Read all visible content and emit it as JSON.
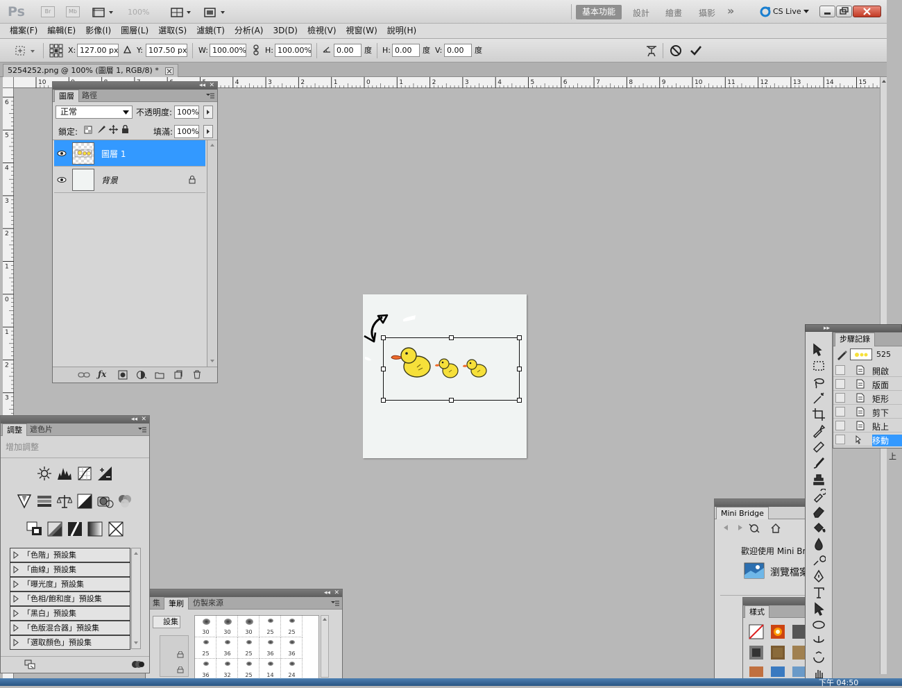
{
  "app": {
    "logo": "Ps",
    "bridge": "Br",
    "minibridge": "Mb",
    "zoom": "100%",
    "workspaces": [
      "基本功能",
      "設計",
      "繪畫",
      "攝影"
    ],
    "more": "»",
    "cslive": "CS Live"
  },
  "menu": [
    "檔案(F)",
    "編輯(E)",
    "影像(I)",
    "圖層(L)",
    "選取(S)",
    "濾鏡(T)",
    "分析(A)",
    "3D(D)",
    "檢視(V)",
    "視窗(W)",
    "說明(H)"
  ],
  "options": {
    "x_label": "X:",
    "x": "127.00 px",
    "y_label": "Y:",
    "y": "107.50 px",
    "w_label": "W:",
    "w": "100.00%",
    "h_label": "H:",
    "h": "100.00%",
    "angle": "0.00",
    "deg": "度",
    "hskew_label": "H:",
    "hskew": "0.00",
    "vskew_label": "V:",
    "vskew": "0.00"
  },
  "document": {
    "tab_title": "5254252.png @ 100% (圖層 1, RGB/8) *"
  },
  "rulers": {
    "h": [
      "10",
      "9",
      "8",
      "7",
      "6",
      "5",
      "4",
      "3",
      "2",
      "1",
      "0",
      "1",
      "2",
      "3",
      "4",
      "5",
      "6",
      "7",
      "8",
      "9",
      "10",
      "11",
      "12",
      "13",
      "14",
      "15"
    ],
    "v": [
      "6",
      "5",
      "4",
      "3",
      "2",
      "1",
      "0",
      "1",
      "2",
      "3"
    ]
  },
  "layers_panel": {
    "tabs": [
      "圖層",
      "路徑"
    ],
    "blend_mode": "正常",
    "opacity_label": "不透明度:",
    "opacity": "100%",
    "lock_label": "鎖定:",
    "fill_label": "填滿:",
    "fill": "100%",
    "layers": [
      {
        "name": "圖層 1"
      },
      {
        "name": "背景"
      }
    ]
  },
  "adjustments_panel": {
    "tabs": [
      "調整",
      "遮色片"
    ],
    "subtitle": "增加調整",
    "presets": [
      "「色階」預設集",
      "「曲線」預設集",
      "「曝光度」預設集",
      "「色相/飽和度」預設集",
      "「黑白」預設集",
      "「色版混合器」預設集",
      "「選取顏色」預設集"
    ]
  },
  "brush_panel": {
    "tabs": [
      "集",
      "筆刷",
      "仿製來源"
    ],
    "preset_label": "設集",
    "sizes": [
      "30",
      "30",
      "30",
      "25",
      "25",
      "25",
      "36",
      "25",
      "36",
      "36",
      "36",
      "32",
      "25",
      "14",
      "24"
    ]
  },
  "history_panel": {
    "tab": "步驟記錄",
    "doc": "525",
    "steps": [
      "開啟",
      "版面",
      "矩形",
      "剪下",
      "貼上",
      "移動"
    ],
    "extra": "上"
  },
  "mini_bridge": {
    "title": "Mini Bridge",
    "welcome": "歡迎使用 Mini Bri",
    "browse": "瀏覽檔案"
  },
  "styles_panel": {
    "tab": "樣式"
  },
  "taskbar": {
    "clock": "下午 04:50"
  }
}
